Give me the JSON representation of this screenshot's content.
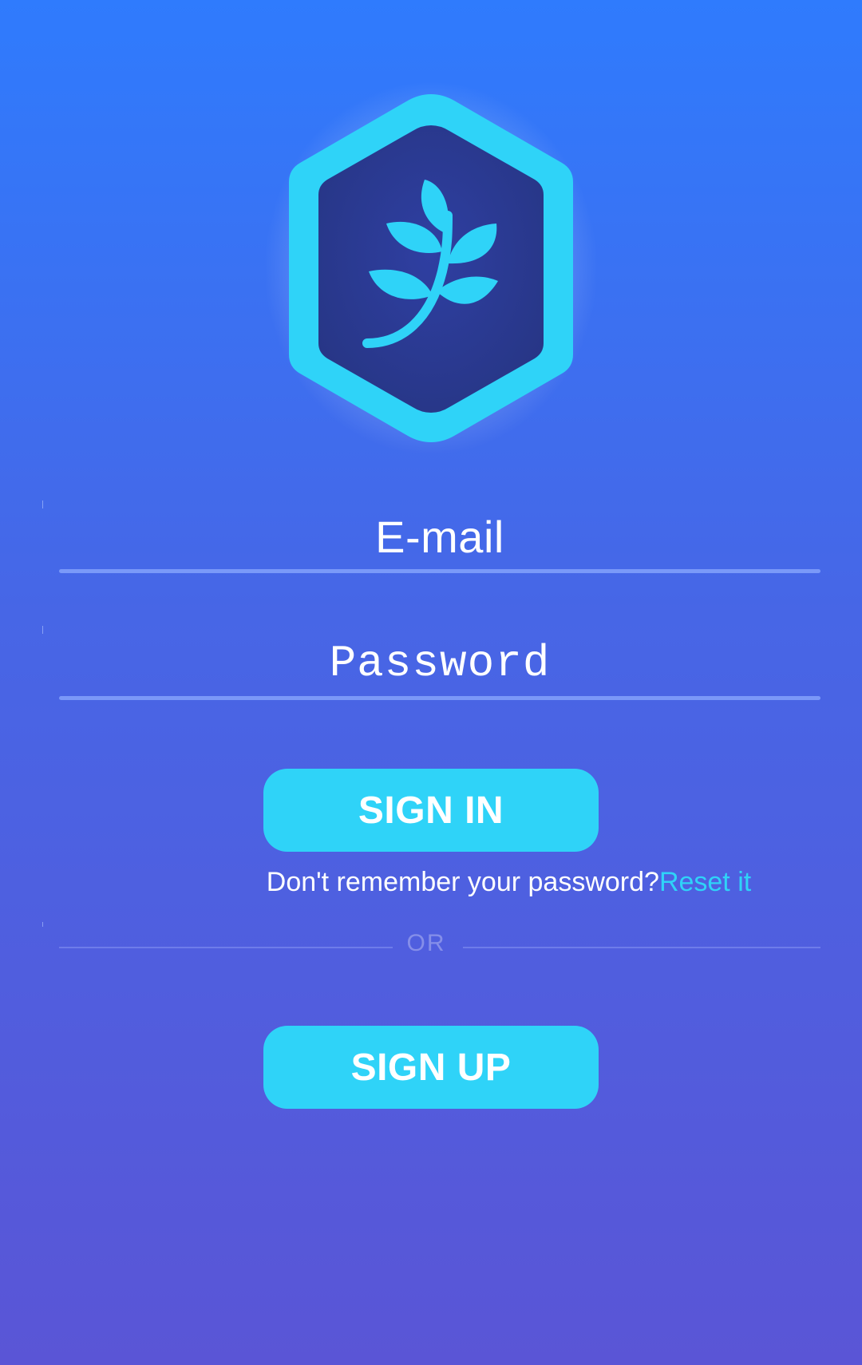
{
  "logo": {
    "icon": "leaf-sprig-hexagon-icon",
    "colors": {
      "ring": "#2fd3f8",
      "fill": "#2a3a94",
      "leaf": "#2fd3f8"
    }
  },
  "form": {
    "email_placeholder": "E-mail",
    "password_placeholder": "Password"
  },
  "actions": {
    "sign_in_label": "SIGN IN",
    "reset_prompt": "Don't remember your password?",
    "reset_link": "Reset it",
    "divider_label": "OR",
    "sign_up_label": "SIGN UP"
  },
  "theme": {
    "gradient_top": "#2f7bfd",
    "gradient_bottom": "#5a55d6",
    "accent": "#2fd3f8"
  }
}
